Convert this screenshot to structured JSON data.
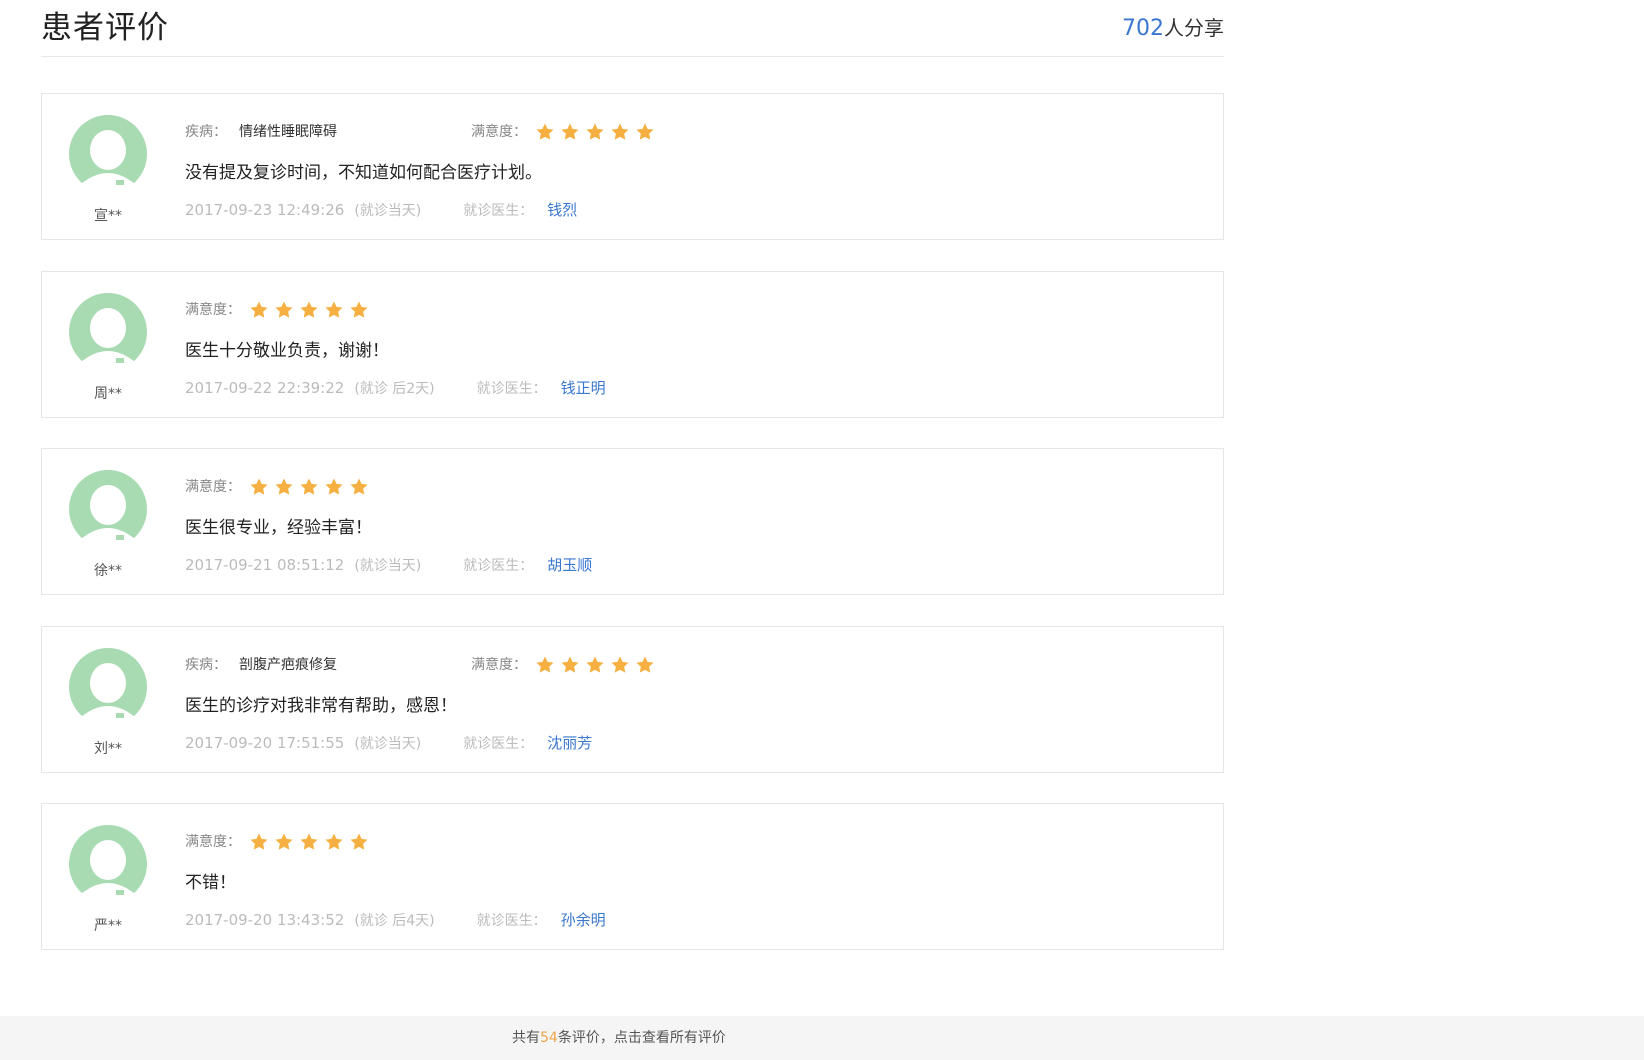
{
  "header": {
    "title": "患者评价",
    "share_count": "702",
    "share_suffix": "人分享"
  },
  "labels": {
    "disease": "疾病：",
    "satisfaction": "满意度：",
    "doctor": "就诊医生："
  },
  "colors": {
    "accent_blue": "#3a77cf",
    "star_orange": "#f5b041",
    "avatar_green": "#a8dbb2",
    "footer_orange": "#f0a44a"
  },
  "reviews": [
    {
      "user": "宣**",
      "disease": "情绪性睡眠障碍",
      "rating": 5,
      "comment": "没有提及复诊时间，不知道如何配合医疗计划。",
      "datetime": "2017-09-23 12:49:26",
      "visit": "(就诊当天)",
      "doctor": "钱烈"
    },
    {
      "user": "周**",
      "disease": "",
      "rating": 5,
      "comment": "医生十分敬业负责，谢谢！",
      "datetime": "2017-09-22 22:39:22",
      "visit": "(就诊 后2天)",
      "doctor": "钱正明"
    },
    {
      "user": "徐**",
      "disease": "",
      "rating": 5,
      "comment": "医生很专业，经验丰富！",
      "datetime": "2017-09-21 08:51:12",
      "visit": "(就诊当天)",
      "doctor": "胡玉顺"
    },
    {
      "user": "刘**",
      "disease": "剖腹产疤痕修复",
      "rating": 5,
      "comment": "医生的诊疗对我非常有帮助，感恩！",
      "datetime": "2017-09-20 17:51:55",
      "visit": "(就诊当天)",
      "doctor": "沈丽芳"
    },
    {
      "user": "严**",
      "disease": "",
      "rating": 5,
      "comment": "不错！",
      "datetime": "2017-09-20 13:43:52",
      "visit": "(就诊 后4天)",
      "doctor": "孙余明"
    }
  ],
  "footer": {
    "prefix": "共有",
    "count": "54",
    "suffix": "条评价，点击查看所有评价"
  }
}
